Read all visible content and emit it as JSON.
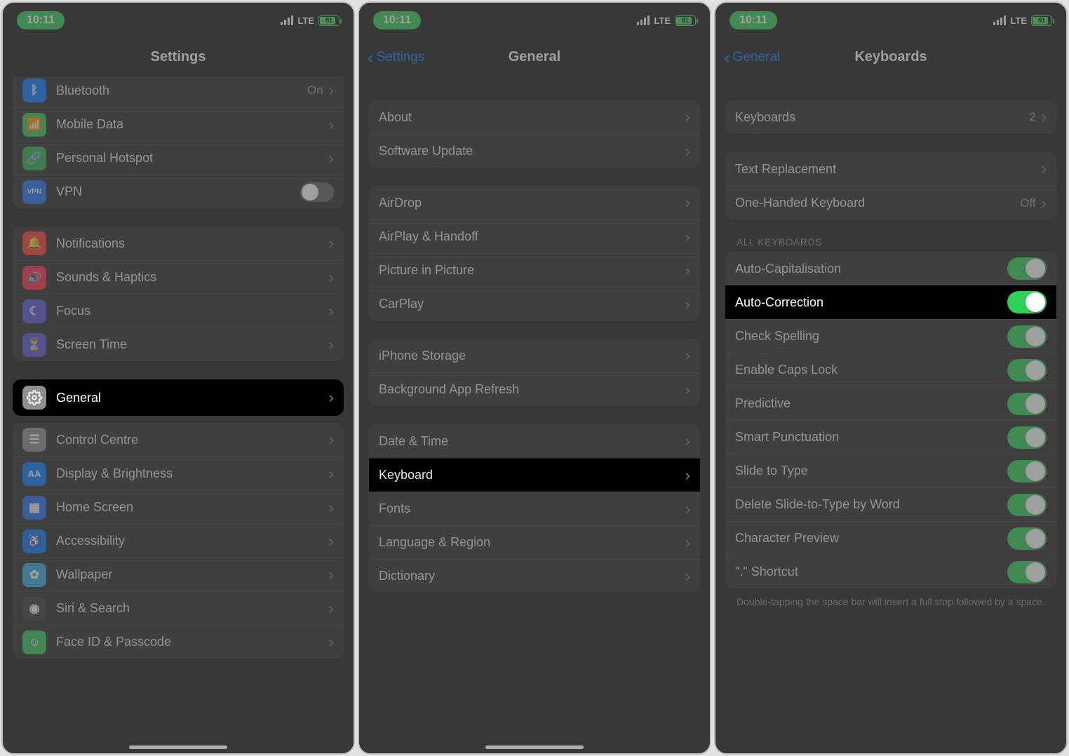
{
  "status": {
    "time": "10:11",
    "network": "LTE",
    "battery_text": "81"
  },
  "panel1": {
    "title": "Settings",
    "rows_g1": [
      {
        "label": "Bluetooth",
        "value": "On",
        "icon": "bluetooth",
        "bg": "bg-blue"
      },
      {
        "label": "Mobile Data",
        "icon": "antenna",
        "bg": "bg-green"
      },
      {
        "label": "Personal Hotspot",
        "icon": "link",
        "bg": "bg-green2"
      },
      {
        "label": "VPN",
        "icon": "vpn",
        "bg": "bg-navy",
        "toggle": "off"
      }
    ],
    "rows_g2": [
      {
        "label": "Notifications",
        "icon": "bell",
        "bg": "bg-red"
      },
      {
        "label": "Sounds & Haptics",
        "icon": "speaker",
        "bg": "bg-pink"
      },
      {
        "label": "Focus",
        "icon": "moon",
        "bg": "bg-purple"
      },
      {
        "label": "Screen Time",
        "icon": "hourglass",
        "bg": "bg-purple"
      }
    ],
    "highlight": {
      "label": "General",
      "icon": "gear",
      "bg": "bg-grey"
    },
    "rows_g3": [
      {
        "label": "Control Centre",
        "icon": "sliders",
        "bg": "bg-grey"
      },
      {
        "label": "Display & Brightness",
        "icon": "aa",
        "bg": "bg-blue"
      },
      {
        "label": "Home Screen",
        "icon": "grid",
        "bg": "bg-navy"
      },
      {
        "label": "Accessibility",
        "icon": "person",
        "bg": "bg-blue"
      },
      {
        "label": "Wallpaper",
        "icon": "flower",
        "bg": "bg-cyan"
      },
      {
        "label": "Siri & Search",
        "icon": "siri",
        "bg": "bg-dark"
      },
      {
        "label": "Face ID & Passcode",
        "icon": "face",
        "bg": "bg-green"
      }
    ]
  },
  "panel2": {
    "back": "Settings",
    "title": "General",
    "g1": [
      "About",
      "Software Update"
    ],
    "g2": [
      "AirDrop",
      "AirPlay & Handoff",
      "Picture in Picture",
      "CarPlay"
    ],
    "g3": [
      "iPhone Storage",
      "Background App Refresh"
    ],
    "g4": [
      "Date & Time",
      "Keyboard",
      "Fonts",
      "Language & Region",
      "Dictionary"
    ],
    "highlight_index_g4": 1
  },
  "panel3": {
    "back": "General",
    "title": "Keyboards",
    "g1": [
      {
        "label": "Keyboards",
        "value": "2"
      }
    ],
    "g2": [
      {
        "label": "Text Replacement"
      },
      {
        "label": "One-Handed Keyboard",
        "value": "Off"
      }
    ],
    "section": "ALL KEYBOARDS",
    "toggles": [
      {
        "label": "Auto-Capitalisation",
        "on": true
      },
      {
        "label": "Auto-Correction",
        "on": true,
        "highlight": true
      },
      {
        "label": "Check Spelling",
        "on": true
      },
      {
        "label": "Enable Caps Lock",
        "on": true
      },
      {
        "label": "Predictive",
        "on": true
      },
      {
        "label": "Smart Punctuation",
        "on": true
      },
      {
        "label": "Slide to Type",
        "on": true
      },
      {
        "label": "Delete Slide-to-Type by Word",
        "on": true
      },
      {
        "label": "Character Preview",
        "on": true
      },
      {
        "label": "\".\" Shortcut",
        "on": true
      }
    ],
    "footer": "Double-tapping the space bar will insert a full stop followed by a space."
  }
}
